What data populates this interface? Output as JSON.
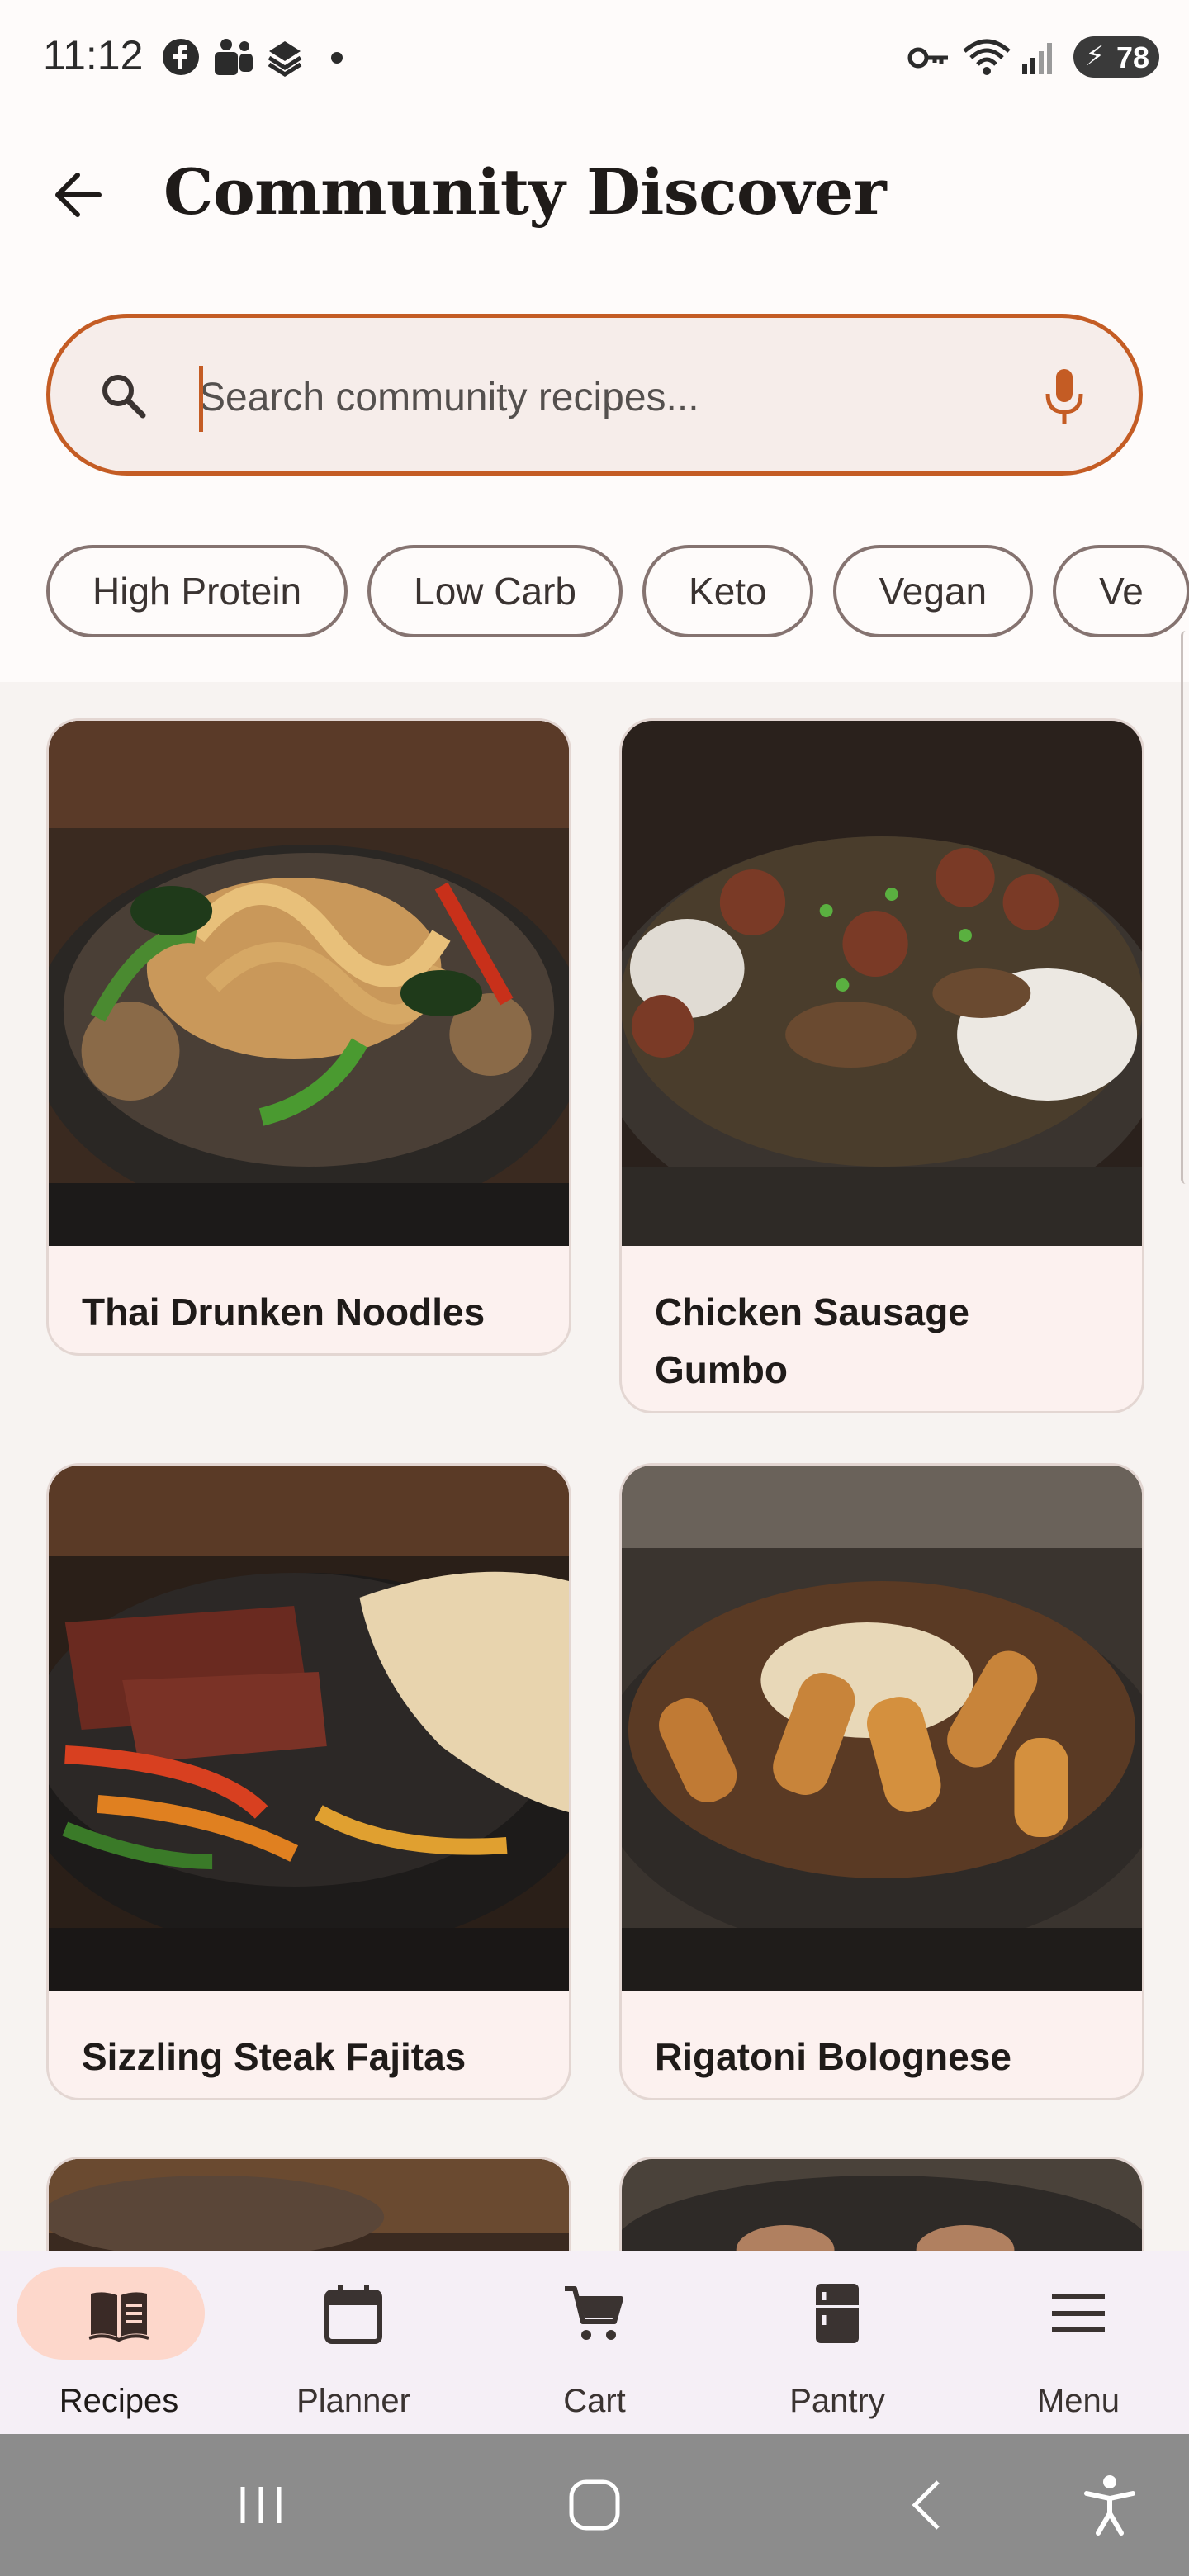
{
  "status_bar": {
    "time": "11:12",
    "battery": "78",
    "notification_icons": [
      "facebook-icon",
      "teams-icon",
      "stack-icon",
      "dot-icon"
    ],
    "system_icons": [
      "key-icon",
      "wifi-icon",
      "signal-icon",
      "battery-icon"
    ]
  },
  "header": {
    "title": "Community Discover"
  },
  "search": {
    "placeholder": "Search community recipes...",
    "accent_color": "#c45c24"
  },
  "filters": [
    "High Protein",
    "Low Carb",
    "Keto",
    "Vegan",
    "Ve"
  ],
  "recipes": [
    {
      "title": "Thai Drunken Noodles"
    },
    {
      "title": "Chicken Sausage Gumbo"
    },
    {
      "title": "Sizzling Steak Fajitas"
    },
    {
      "title": "Rigatoni Bolognese"
    }
  ],
  "bottom_nav": {
    "items": [
      {
        "label": "Recipes",
        "icon": "book-icon",
        "active": true
      },
      {
        "label": "Planner",
        "icon": "calendar-icon",
        "active": false
      },
      {
        "label": "Cart",
        "icon": "cart-icon",
        "active": false
      },
      {
        "label": "Pantry",
        "icon": "fridge-icon",
        "active": false
      },
      {
        "label": "Menu",
        "icon": "hamburger-menu-icon",
        "active": false
      }
    ]
  },
  "colors": {
    "accent": "#c45c24",
    "active_nav": "#fdd7cb",
    "card_bg": "#fcf1ef",
    "nav_bg": "#f5eff6"
  }
}
